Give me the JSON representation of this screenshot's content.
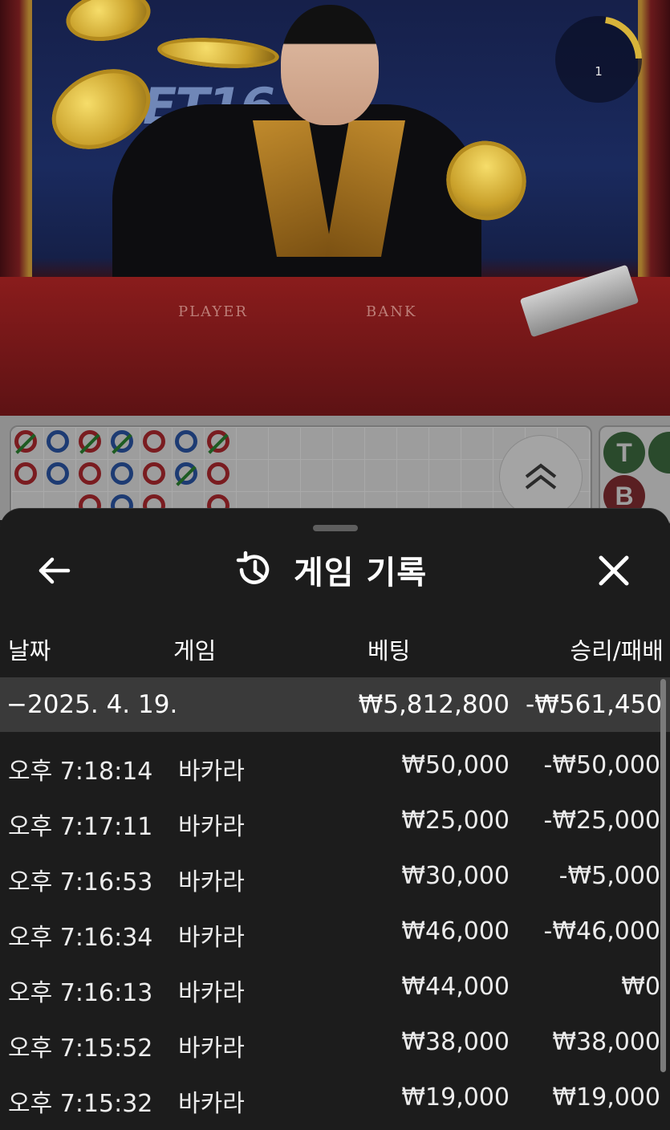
{
  "video": {
    "brand_text": "ET16",
    "table_player_label": "PLAYER",
    "table_banker_label": "BANK",
    "timer_value": "1"
  },
  "roadmap": {
    "stats_labels": [
      "T",
      "B"
    ]
  },
  "sheet": {
    "title": "게임 기록",
    "back_icon": "arrow-left-icon",
    "history_icon": "history-icon",
    "close_icon": "close-icon",
    "columns": {
      "date": "날짜",
      "game": "게임",
      "bet": "베팅",
      "result": "승리/패배"
    },
    "summary": {
      "date": "−2025. 4. 19.",
      "bet": "₩5,812,800",
      "result": "-₩561,450"
    },
    "rows": [
      {
        "time": "오후 7:18:14",
        "game": "바카라",
        "bet": "₩50,000",
        "result": "-₩50,000"
      },
      {
        "time": "오후 7:17:11",
        "game": "바카라",
        "bet": "₩25,000",
        "result": "-₩25,000"
      },
      {
        "time": "오후 7:16:53",
        "game": "바카라",
        "bet": "₩30,000",
        "result": "-₩5,000"
      },
      {
        "time": "오후 7:16:34",
        "game": "바카라",
        "bet": "₩46,000",
        "result": "-₩46,000"
      },
      {
        "time": "오후 7:16:13",
        "game": "바카라",
        "bet": "₩44,000",
        "result": "₩0"
      },
      {
        "time": "오후 7:15:52",
        "game": "바카라",
        "bet": "₩38,000",
        "result": "₩38,000"
      },
      {
        "time": "오후 7:15:32",
        "game": "바카라",
        "bet": "₩19,000",
        "result": "₩19,000"
      }
    ]
  },
  "colors": {
    "sheet_bg": "#1c1c1c",
    "summary_bg": "#3a3a3a",
    "text": "#ffffff",
    "banker_red": "#7a1c20",
    "player_blue": "#1d3b73",
    "tie_green": "#1e5c22"
  }
}
